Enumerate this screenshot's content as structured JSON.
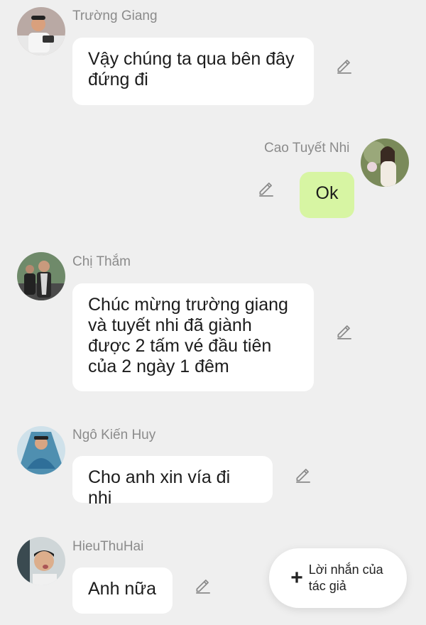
{
  "messages": [
    {
      "sender": "Trường Giang",
      "text": "Vậy chúng ta qua bên đây đứng đi"
    },
    {
      "sender": "Cao Tuyết Nhi",
      "text": "Ok"
    },
    {
      "sender": "Chị Thắm",
      "text": "Chúc mừng trường giang và tuyết nhi đã giành được 2 tấm vé đầu tiên của 2 ngày 1 đêm"
    },
    {
      "sender": "Ngô Kiến Huy",
      "text": "Cho anh xin vía đi nhi"
    },
    {
      "sender": "HieuThuHai",
      "text": "Anh nữa"
    }
  ],
  "fab": {
    "icon": "plus-icon",
    "label": "Lời nhắn của tác giả"
  },
  "colors": {
    "background": "#efefef",
    "bubble": "#ffffff",
    "own_bubble": "#d7f5a3",
    "sender_name": "#8b8b8b"
  }
}
